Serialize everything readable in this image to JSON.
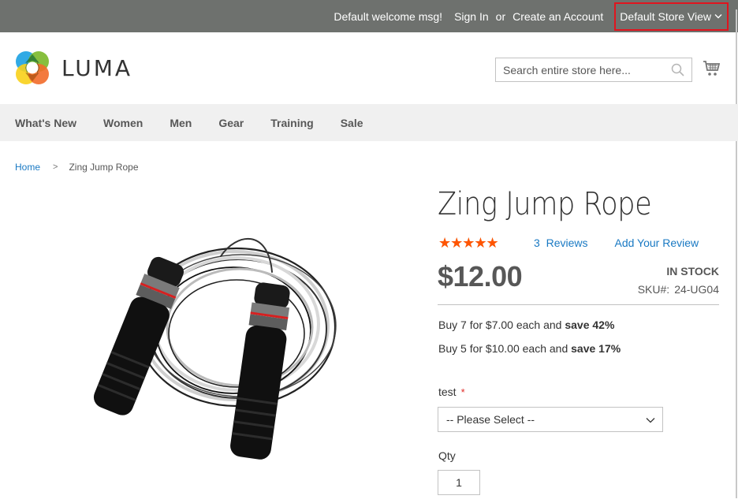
{
  "topbar": {
    "welcome": "Default welcome msg!",
    "sign_in": "Sign In",
    "or": "or",
    "create_account": "Create an Account",
    "store_view": "Default Store View"
  },
  "header": {
    "logo_text": "LUMA",
    "search_placeholder": "Search entire store here...",
    "search_value": ""
  },
  "nav": {
    "items": [
      {
        "label": "What's New"
      },
      {
        "label": "Women"
      },
      {
        "label": "Men"
      },
      {
        "label": "Gear"
      },
      {
        "label": "Training"
      },
      {
        "label": "Sale"
      }
    ]
  },
  "breadcrumb": {
    "home": "Home",
    "separator": ">",
    "current": "Zing Jump Rope"
  },
  "product": {
    "title": "Zing Jump Rope",
    "rating_percent": 93,
    "stars_glyph": "★★★★★",
    "reviews_count": "3",
    "reviews_label": "Reviews",
    "add_review": "Add Your Review",
    "price": "$12.00",
    "stock": "IN STOCK",
    "sku_label": "SKU#:",
    "sku": "24-UG04",
    "tier_prices": [
      {
        "text": "Buy 7 for $7.00 each and ",
        "save": "save 42%"
      },
      {
        "text": "Buy 5 for $10.00 each and ",
        "save": "save 17%"
      }
    ],
    "option_label": "test",
    "option_required": "*",
    "option_selected": "-- Please Select --",
    "qty_label": "Qty",
    "qty_value": "1"
  },
  "colors": {
    "topbar_bg": "#6e716e",
    "link": "#1979c3",
    "star": "#ff5501",
    "highlight_border": "#e0141e"
  }
}
